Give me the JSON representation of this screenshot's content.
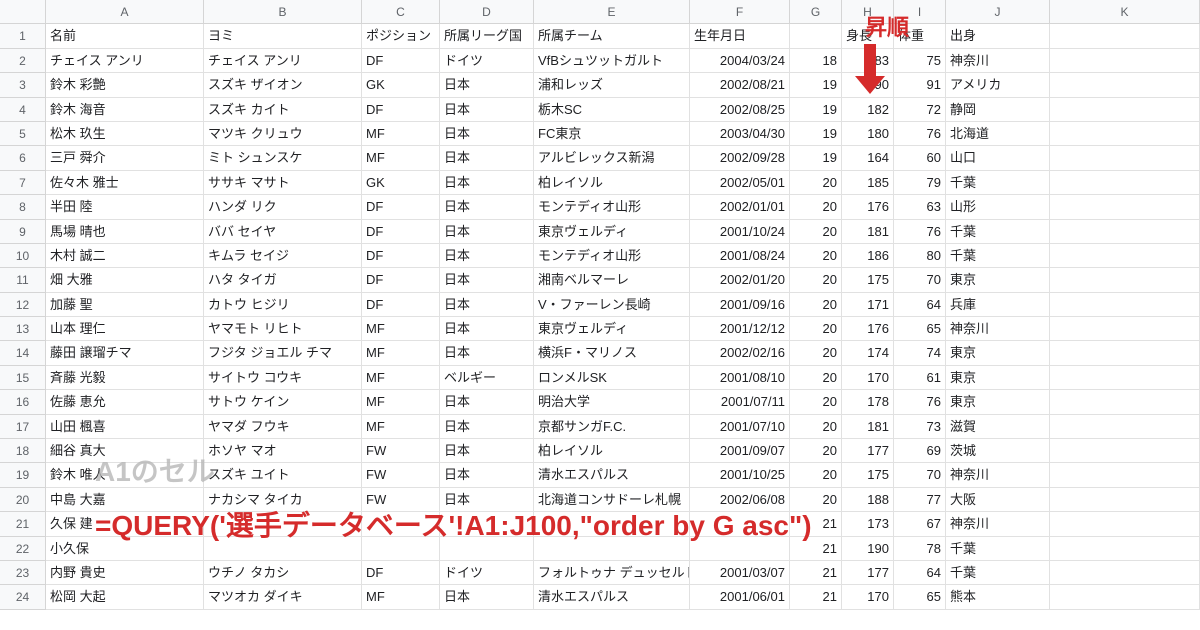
{
  "columns": [
    "",
    "A",
    "B",
    "C",
    "D",
    "E",
    "F",
    "G",
    "H",
    "I",
    "J",
    "K"
  ],
  "row_count": 24,
  "headers": [
    "名前",
    "ヨミ",
    "ポジション",
    "所属リーグ国",
    "所属チーム",
    "生年月日",
    "",
    "身長",
    "体重",
    "出身",
    ""
  ],
  "rows": [
    [
      "チェイス アンリ",
      "チェイス アンリ",
      "DF",
      "ドイツ",
      "VfBシュツットガルト",
      "2004/03/24",
      "18",
      "183",
      "75",
      "神奈川",
      ""
    ],
    [
      "鈴木 彩艶",
      "スズキ ザイオン",
      "GK",
      "日本",
      "浦和レッズ",
      "2002/08/21",
      "19",
      "190",
      "91",
      "アメリカ",
      ""
    ],
    [
      "鈴木 海音",
      "スズキ カイト",
      "DF",
      "日本",
      "栃木SC",
      "2002/08/25",
      "19",
      "182",
      "72",
      "静岡",
      ""
    ],
    [
      "松木 玖生",
      "マツキ クリュウ",
      "MF",
      "日本",
      "FC東京",
      "2003/04/30",
      "19",
      "180",
      "76",
      "北海道",
      ""
    ],
    [
      "三戸 舜介",
      "ミト シュンスケ",
      "MF",
      "日本",
      "アルビレックス新潟",
      "2002/09/28",
      "19",
      "164",
      "60",
      "山口",
      ""
    ],
    [
      "佐々木 雅士",
      "ササキ マサト",
      "GK",
      "日本",
      "柏レイソル",
      "2002/05/01",
      "20",
      "185",
      "79",
      "千葉",
      ""
    ],
    [
      "半田 陸",
      "ハンダ リク",
      "DF",
      "日本",
      "モンテディオ山形",
      "2002/01/01",
      "20",
      "176",
      "63",
      "山形",
      ""
    ],
    [
      "馬場 晴也",
      "ババ セイヤ",
      "DF",
      "日本",
      "東京ヴェルディ",
      "2001/10/24",
      "20",
      "181",
      "76",
      "千葉",
      ""
    ],
    [
      "木村 誠二",
      "キムラ セイジ",
      "DF",
      "日本",
      "モンテディオ山形",
      "2001/08/24",
      "20",
      "186",
      "80",
      "千葉",
      ""
    ],
    [
      "畑 大雅",
      "ハタ タイガ",
      "DF",
      "日本",
      "湘南ベルマーレ",
      "2002/01/20",
      "20",
      "175",
      "70",
      "東京",
      ""
    ],
    [
      "加藤 聖",
      "カトウ ヒジリ",
      "DF",
      "日本",
      "V・ファーレン長崎",
      "2001/09/16",
      "20",
      "171",
      "64",
      "兵庫",
      ""
    ],
    [
      "山本 理仁",
      "ヤマモト リヒト",
      "MF",
      "日本",
      "東京ヴェルディ",
      "2001/12/12",
      "20",
      "176",
      "65",
      "神奈川",
      ""
    ],
    [
      "藤田 譲瑠チマ",
      "フジタ ジョエル チマ",
      "MF",
      "日本",
      "横浜F・マリノス",
      "2002/02/16",
      "20",
      "174",
      "74",
      "東京",
      ""
    ],
    [
      "斉藤 光毅",
      "サイトウ コウキ",
      "MF",
      "ベルギー",
      "ロンメルSK",
      "2001/08/10",
      "20",
      "170",
      "61",
      "東京",
      ""
    ],
    [
      "佐藤 恵允",
      "サトウ ケイン",
      "MF",
      "日本",
      "明治大学",
      "2001/07/11",
      "20",
      "178",
      "76",
      "東京",
      ""
    ],
    [
      "山田 楓喜",
      "ヤマダ フウキ",
      "MF",
      "日本",
      "京都サンガF.C.",
      "2001/07/10",
      "20",
      "181",
      "73",
      "滋賀",
      ""
    ],
    [
      "細谷 真大",
      "ホソヤ マオ",
      "FW",
      "日本",
      "柏レイソル",
      "2001/09/07",
      "20",
      "177",
      "69",
      "茨城",
      ""
    ],
    [
      "鈴木 唯人",
      "スズキ ユイト",
      "FW",
      "日本",
      "清水エスパルス",
      "2001/10/25",
      "20",
      "175",
      "70",
      "神奈川",
      ""
    ],
    [
      "中島 大嘉",
      "ナカシマ タイカ",
      "FW",
      "日本",
      "北海道コンサドーレ札幌",
      "2002/06/08",
      "20",
      "188",
      "77",
      "大阪",
      ""
    ],
    [
      "久保 建",
      "",
      "",
      "",
      "",
      "",
      "21",
      "173",
      "67",
      "神奈川",
      ""
    ],
    [
      "小久保",
      "",
      "",
      "",
      "",
      "",
      "21",
      "190",
      "78",
      "千葉",
      ""
    ],
    [
      "内野 貴史",
      "ウチノ タカシ",
      "DF",
      "ドイツ",
      "フォルトゥナ デュッセルドルフ",
      "2001/03/07",
      "21",
      "177",
      "64",
      "千葉",
      ""
    ],
    [
      "松岡 大起",
      "マツオカ ダイキ",
      "MF",
      "日本",
      "清水エスパルス",
      "2001/06/01",
      "21",
      "170",
      "65",
      "熊本",
      ""
    ]
  ],
  "annotations": {
    "sort_label": "昇順",
    "a1_label": "A1のセル",
    "formula": "=QUERY('選手データベース'!A1:J100,\"order by G asc\")"
  }
}
